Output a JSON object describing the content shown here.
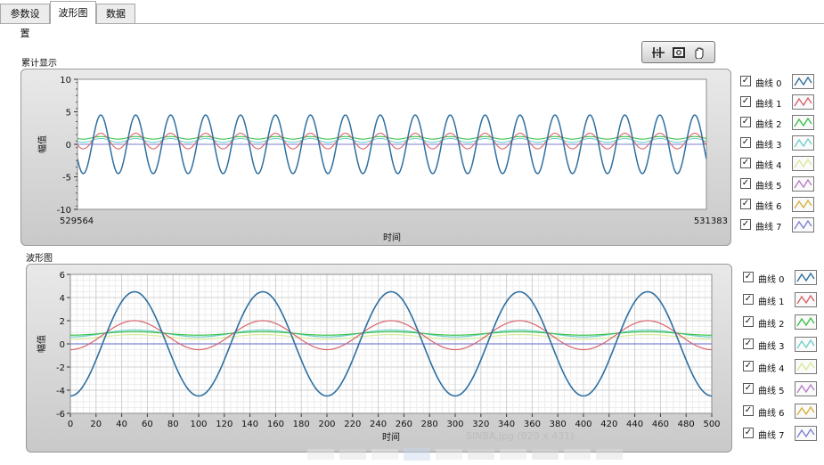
{
  "tabs": [
    {
      "label": "参数设置",
      "active": false
    },
    {
      "label": "波形图",
      "active": true
    },
    {
      "label": "数据",
      "active": false
    }
  ],
  "palette": {
    "tools": [
      "zoom-icon",
      "cursor-icon",
      "pan-icon"
    ]
  },
  "graphs": [
    {
      "title": "累计显示",
      "xlabel": "时间",
      "ylabel": "幅值",
      "xmin_label": "529564",
      "xmax_label": "531383",
      "yticks": [
        10,
        5,
        0,
        -5,
        -10
      ],
      "grid": false
    },
    {
      "title": "波形图",
      "xlabel": "时间",
      "ylabel": "幅值",
      "xticks": [
        0,
        20,
        40,
        60,
        80,
        100,
        120,
        140,
        160,
        180,
        200,
        220,
        240,
        260,
        280,
        300,
        320,
        340,
        360,
        380,
        400,
        420,
        440,
        460,
        480,
        500
      ],
      "yticks": [
        6,
        4,
        2,
        0,
        -2,
        -4,
        -6
      ],
      "grid": true
    }
  ],
  "legend": {
    "items": [
      {
        "label": "曲线 0",
        "checked": true,
        "color": "#2e6fa0"
      },
      {
        "label": "曲线 1",
        "checked": true,
        "color": "#d9636a"
      },
      {
        "label": "曲线 2",
        "checked": true,
        "color": "#3cc24a"
      },
      {
        "label": "曲线 3",
        "checked": true,
        "color": "#6fd0cc"
      },
      {
        "label": "曲线 4",
        "checked": true,
        "color": "#d8ea9a"
      },
      {
        "label": "曲线 5",
        "checked": true,
        "color": "#b77ec9"
      },
      {
        "label": "曲线 6",
        "checked": true,
        "color": "#d6b13a"
      },
      {
        "label": "曲线 7",
        "checked": true,
        "color": "#7d82d3"
      }
    ]
  },
  "chart_data": [
    {
      "type": "line",
      "title": "累计显示",
      "xlabel": "时间",
      "ylabel": "幅值",
      "xlim": [
        529564,
        531383
      ],
      "ylim": [
        -10,
        10
      ],
      "series": [
        {
          "name": "曲线 0",
          "amplitude": 4.5,
          "offset": 0,
          "cycles": 18,
          "phase_deg": 120
        },
        {
          "name": "曲线 1",
          "amplitude": 1.2,
          "offset": 0.5,
          "cycles": 18,
          "phase_deg": 120
        },
        {
          "name": "曲线 2",
          "amplitude": 0.2,
          "offset": 1.0,
          "cycles": 18,
          "phase_deg": 120
        },
        {
          "name": "曲线 3",
          "amplitude": 0.3,
          "offset": 0.6,
          "cycles": 18,
          "phase_deg": 120
        },
        {
          "name": "曲线 7",
          "amplitude": 0,
          "offset": 0,
          "cycles": 18,
          "phase_deg": 0
        }
      ]
    },
    {
      "type": "line",
      "title": "波形图",
      "xlabel": "时间",
      "ylabel": "幅值",
      "xlim": [
        0,
        500
      ],
      "ylim": [
        -6,
        6
      ],
      "series": [
        {
          "name": "曲线 0",
          "amplitude": 4.5,
          "offset": 0,
          "period": 100,
          "phase_deg": 270,
          "peaks_x": [
            47,
            147,
            247,
            347,
            447
          ]
        },
        {
          "name": "曲线 1",
          "amplitude": 1.25,
          "offset": 0.75,
          "period": 100,
          "phase_deg": 270
        },
        {
          "name": "曲线 2",
          "amplitude": 0.15,
          "offset": 0.9,
          "period": 100,
          "phase_deg": 270
        },
        {
          "name": "曲线 3",
          "amplitude": 0.3,
          "offset": 0.9,
          "period": 100,
          "phase_deg": 270
        },
        {
          "name": "曲线 4",
          "amplitude": 0.2,
          "offset": 0.6,
          "period": 100,
          "phase_deg": 270
        },
        {
          "name": "曲线 7",
          "amplitude": 0,
          "offset": 0,
          "period": 100,
          "phase_deg": 0
        }
      ]
    }
  ],
  "watermark": "SINBA.jpg (920 x 431)"
}
